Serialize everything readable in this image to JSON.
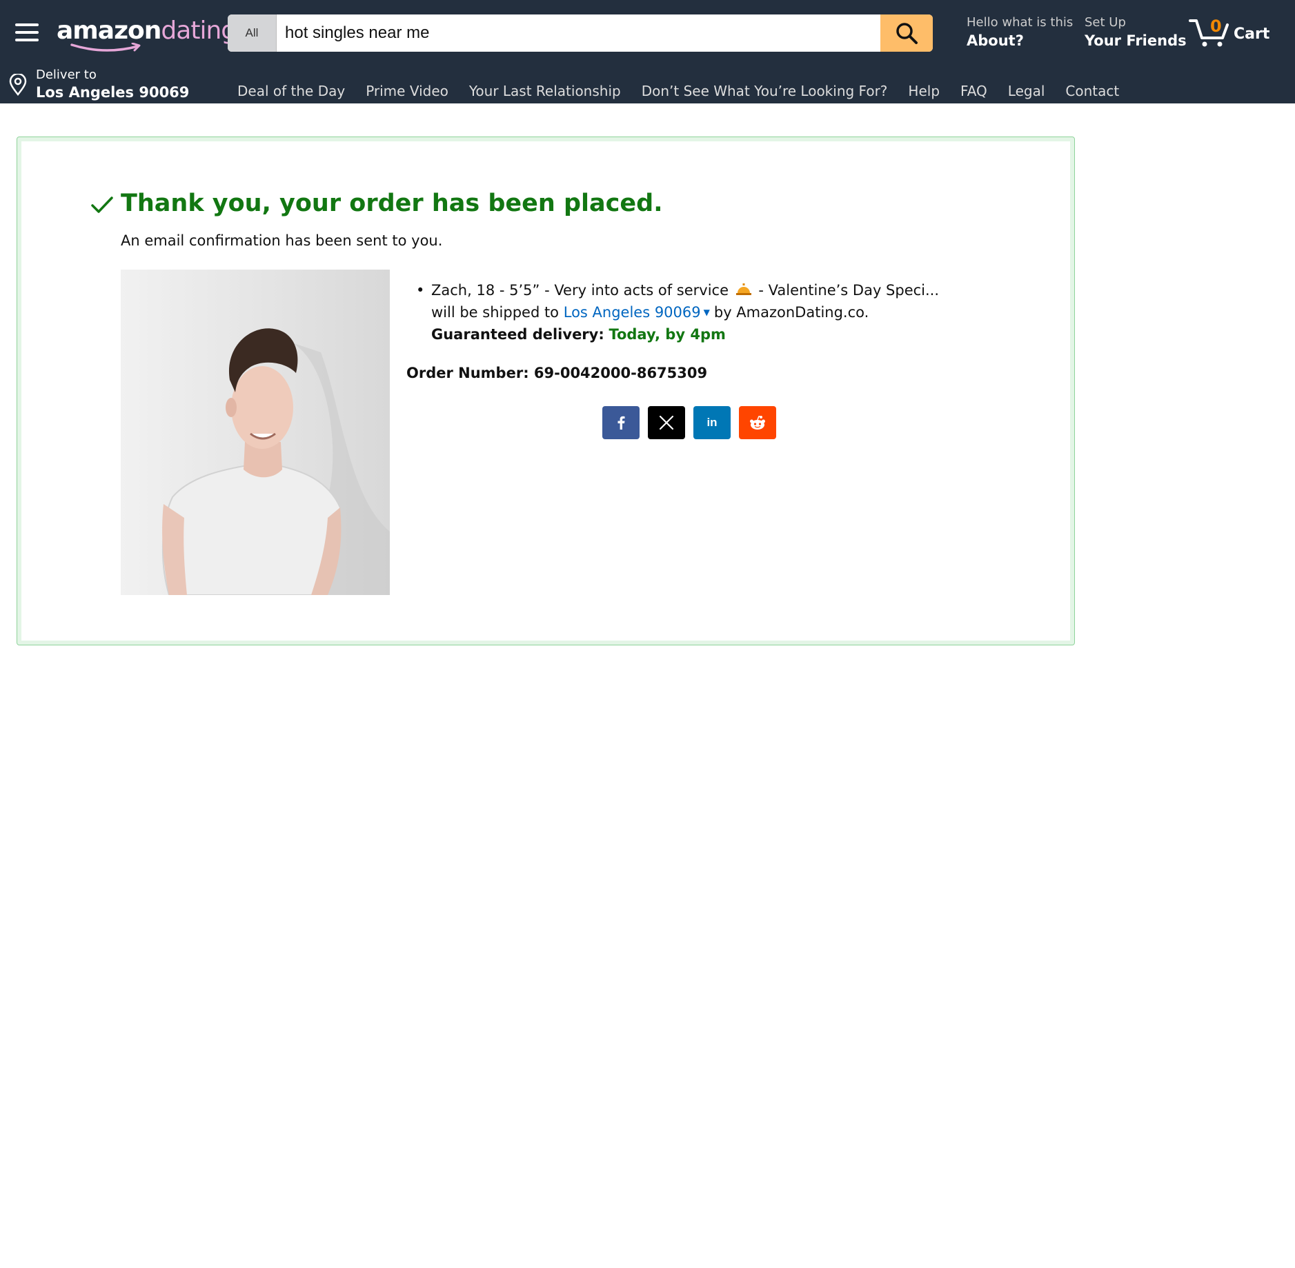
{
  "header": {
    "logo_amazon": "amazon",
    "logo_dating": "dating",
    "search": {
      "category": "All",
      "query": "hot singles near me"
    },
    "about": {
      "line1": "Hello what is this",
      "line2": "About?"
    },
    "friends": {
      "line1": "Set Up",
      "line2": "Your Friends"
    },
    "cart": {
      "count": "0",
      "label": "Cart"
    },
    "deliver": {
      "line1": "Deliver to",
      "line2": "Los Angeles 90069"
    },
    "nav": [
      "Deal of the Day",
      "Prime Video",
      "Your Last Relationship",
      "Don’t See What You’re Looking For?",
      "Help",
      "FAQ",
      "Legal",
      "Contact"
    ]
  },
  "confirmation": {
    "title": "Thank you, your order has been placed.",
    "email_note": "An email confirmation has been sent to you.",
    "item": {
      "name_part1": "Zach, 18 - 5’5” - Very into acts of service",
      "name_part2": "- Valentine’s Day Speci... will be shipped to",
      "ship_location": "Los Angeles 90069",
      "seller": "by AmazonDating.co.",
      "delivery_label": "Guaranteed delivery:",
      "delivery_time": "Today, by 4pm"
    },
    "order_number": "Order Number: 69-0042000-8675309",
    "share_buttons": [
      "facebook-icon",
      "x-icon",
      "linkedin-icon",
      "reddit-icon"
    ]
  },
  "colors": {
    "header_bg": "#232f3e",
    "search_button": "#febd69",
    "success_green": "#127712",
    "link_blue": "#0066c0",
    "cart_count": "#f08804",
    "logo_pink": "#e6a7d8"
  }
}
